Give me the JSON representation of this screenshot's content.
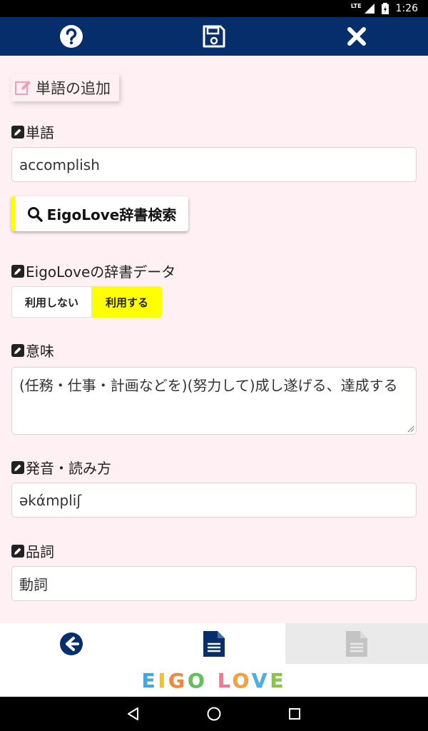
{
  "status_bar": {
    "network": "LTE",
    "time": "1:26"
  },
  "toolbar": {
    "help": "help-icon",
    "save": "save-icon",
    "close": "close-icon"
  },
  "section": {
    "title": "単語の追加"
  },
  "fields": {
    "word": {
      "label": "単語",
      "value": "accomplish"
    },
    "search_button": "EigoLove辞書検索",
    "dict_data": {
      "label": "EigoLoveの辞書データ",
      "options": [
        "利用しない",
        "利用する"
      ],
      "selected": "利用する"
    },
    "meaning": {
      "label": "意味",
      "value": "(任務・仕事・計画などを)(努力して)成し遂げる、達成する"
    },
    "pronunciation": {
      "label": "発音・読み方",
      "value": "əkάmpliʃ"
    },
    "part_of_speech": {
      "label": "品詞",
      "value": "動詞"
    }
  },
  "logo": {
    "letters": [
      "E",
      "I",
      "G",
      "O",
      " ",
      "L",
      "O",
      "V",
      "E"
    ]
  },
  "colors": {
    "navy": "#062e6b",
    "accent_yellow": "#ffff00",
    "background": "#fff0f3"
  }
}
